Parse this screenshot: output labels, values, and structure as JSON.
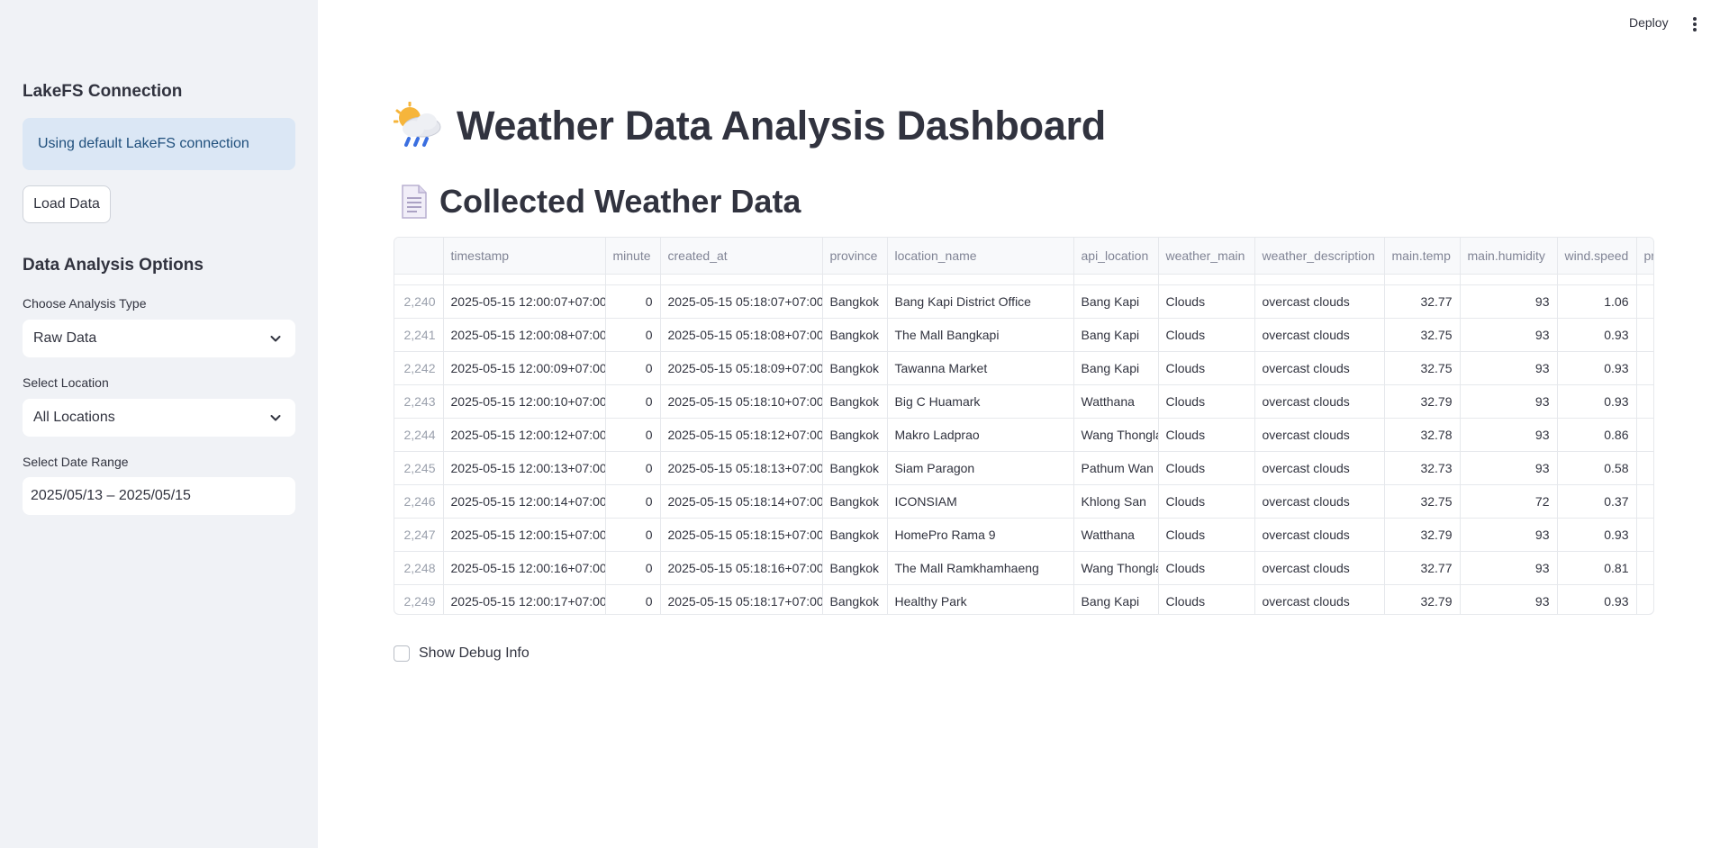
{
  "topbar": {
    "deploy_label": "Deploy",
    "menu_icon": "vertical-dots-icon"
  },
  "sidebar": {
    "connection_title": "LakeFS Connection",
    "connection_info": "Using default LakeFS connection",
    "load_button": "Load Data",
    "options_title": "Data Analysis Options",
    "analysis_type": {
      "label": "Choose Analysis Type",
      "value": "Raw Data"
    },
    "location": {
      "label": "Select Location",
      "value": "All Locations"
    },
    "date_range": {
      "label": "Select Date Range",
      "value": "2025/05/13 – 2025/05/15"
    }
  },
  "main": {
    "title": "Weather Data Analysis Dashboard",
    "title_icon": "cloud-rain-sun-icon",
    "subtitle": "Collected Weather Data",
    "subtitle_icon": "document-icon",
    "debug_label": "Show Debug Info"
  },
  "table": {
    "columns": [
      "",
      "timestamp",
      "minute",
      "created_at",
      "province",
      "location_name",
      "api_location",
      "weather_main",
      "weather_description",
      "main.temp",
      "main.humidity",
      "wind.speed",
      "pre"
    ],
    "rows": [
      [
        "2,240",
        "2025-05-15 12:00:07+07:00",
        "0",
        "2025-05-15 05:18:07+07:00",
        "Bangkok",
        "Bang Kapi District Office",
        "Bang Kapi",
        "Clouds",
        "overcast clouds",
        "32.77",
        "93",
        "1.06",
        ""
      ],
      [
        "2,241",
        "2025-05-15 12:00:08+07:00",
        "0",
        "2025-05-15 05:18:08+07:00",
        "Bangkok",
        "The Mall Bangkapi",
        "Bang Kapi",
        "Clouds",
        "overcast clouds",
        "32.75",
        "93",
        "0.93",
        ""
      ],
      [
        "2,242",
        "2025-05-15 12:00:09+07:00",
        "0",
        "2025-05-15 05:18:09+07:00",
        "Bangkok",
        "Tawanna Market",
        "Bang Kapi",
        "Clouds",
        "overcast clouds",
        "32.75",
        "93",
        "0.93",
        ""
      ],
      [
        "2,243",
        "2025-05-15 12:00:10+07:00",
        "0",
        "2025-05-15 05:18:10+07:00",
        "Bangkok",
        "Big C Huamark",
        "Watthana",
        "Clouds",
        "overcast clouds",
        "32.79",
        "93",
        "0.93",
        ""
      ],
      [
        "2,244",
        "2025-05-15 12:00:12+07:00",
        "0",
        "2025-05-15 05:18:12+07:00",
        "Bangkok",
        "Makro Ladprao",
        "Wang Thonglang",
        "Clouds",
        "overcast clouds",
        "32.78",
        "93",
        "0.86",
        ""
      ],
      [
        "2,245",
        "2025-05-15 12:00:13+07:00",
        "0",
        "2025-05-15 05:18:13+07:00",
        "Bangkok",
        "Siam Paragon",
        "Pathum Wan",
        "Clouds",
        "overcast clouds",
        "32.73",
        "93",
        "0.58",
        ""
      ],
      [
        "2,246",
        "2025-05-15 12:00:14+07:00",
        "0",
        "2025-05-15 05:18:14+07:00",
        "Bangkok",
        "ICONSIAM",
        "Khlong San",
        "Clouds",
        "overcast clouds",
        "32.75",
        "72",
        "0.37",
        ""
      ],
      [
        "2,247",
        "2025-05-15 12:00:15+07:00",
        "0",
        "2025-05-15 05:18:15+07:00",
        "Bangkok",
        "HomePro Rama 9",
        "Watthana",
        "Clouds",
        "overcast clouds",
        "32.79",
        "93",
        "0.93",
        ""
      ],
      [
        "2,248",
        "2025-05-15 12:00:16+07:00",
        "0",
        "2025-05-15 05:18:16+07:00",
        "Bangkok",
        "The Mall Ramkhamhaeng",
        "Wang Thonglang",
        "Clouds",
        "overcast clouds",
        "32.77",
        "93",
        "0.81",
        ""
      ],
      [
        "2,249",
        "2025-05-15 12:00:17+07:00",
        "0",
        "2025-05-15 05:18:17+07:00",
        "Bangkok",
        "Healthy Park",
        "Bang Kapi",
        "Clouds",
        "overcast clouds",
        "32.79",
        "93",
        "0.93",
        ""
      ]
    ]
  }
}
